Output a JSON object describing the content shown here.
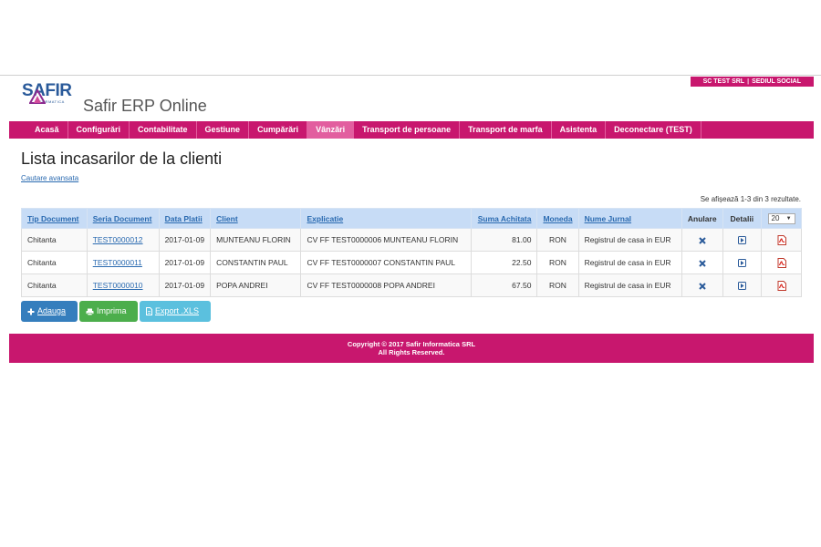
{
  "header": {
    "company": "SC TEST SRL",
    "office": "SEDIUL SOCIAL",
    "logo_text": "SAFIR",
    "logo_sub": "INFORMATICA",
    "app_title": "Safir ERP Online"
  },
  "nav": {
    "items": [
      {
        "label": "Acasă"
      },
      {
        "label": "Configurări"
      },
      {
        "label": "Contabilitate"
      },
      {
        "label": "Gestiune"
      },
      {
        "label": "Cumpărări"
      },
      {
        "label": "Vânzări"
      },
      {
        "label": "Transport de persoane"
      },
      {
        "label": "Transport de marfa"
      },
      {
        "label": "Asistenta"
      },
      {
        "label": "Deconectare (TEST)"
      }
    ],
    "active": "Vânzări"
  },
  "page": {
    "title": "Lista incasarilor de la clienti",
    "advanced_search": "Cautare avansata",
    "results_info": "Se afișează 1-3 din 3 rezultate."
  },
  "table": {
    "columns": {
      "tip": "Tip Document",
      "serie": "Seria Document",
      "data": "Data Platii",
      "client": "Client",
      "explicatie": "Explicatie",
      "suma": "Suma Achitata",
      "moneda": "Moneda",
      "jurnal": "Nume Jurnal",
      "anulare": "Anulare",
      "detalii": "Detalii"
    },
    "per_page": "20",
    "rows": [
      {
        "tip": "Chitanta",
        "serie": "TEST0000012",
        "data": "2017-01-09",
        "client": "MUNTEANU FLORIN",
        "explicatie": "CV FF TEST0000006 MUNTEANU FLORIN",
        "suma": "81.00",
        "moneda": "RON",
        "jurnal": "Registrul de casa in EUR"
      },
      {
        "tip": "Chitanta",
        "serie": "TEST0000011",
        "data": "2017-01-09",
        "client": "CONSTANTIN PAUL",
        "explicatie": "CV FF TEST0000007 CONSTANTIN PAUL",
        "suma": "22.50",
        "moneda": "RON",
        "jurnal": "Registrul de casa in EUR"
      },
      {
        "tip": "Chitanta",
        "serie": "TEST0000010",
        "data": "2017-01-09",
        "client": "POPA ANDREI",
        "explicatie": "CV FF TEST0000008 POPA ANDREI",
        "suma": "67.50",
        "moneda": "RON",
        "jurnal": "Registrul de casa in EUR"
      }
    ]
  },
  "buttons": {
    "add": "Adauga",
    "print": "Imprima",
    "export": "Export .XLS"
  },
  "footer": {
    "line1": "Copyright © 2017 Safir Informatica SRL",
    "line2": "All Rights Reserved."
  },
  "icons": {
    "cancel": "close-icon",
    "details": "arrow-right-box-icon",
    "pdf": "pdf-icon",
    "add": "plus-icon",
    "print": "printer-icon",
    "export": "file-icon"
  },
  "colors": {
    "brand": "#c8176e",
    "nav_active": "#e25e9f",
    "header_row": "#c7dcf6",
    "link": "#2a6ab0",
    "btn_add": "#357ebd",
    "btn_print": "#4cae4c",
    "btn_export": "#5bc0de"
  }
}
